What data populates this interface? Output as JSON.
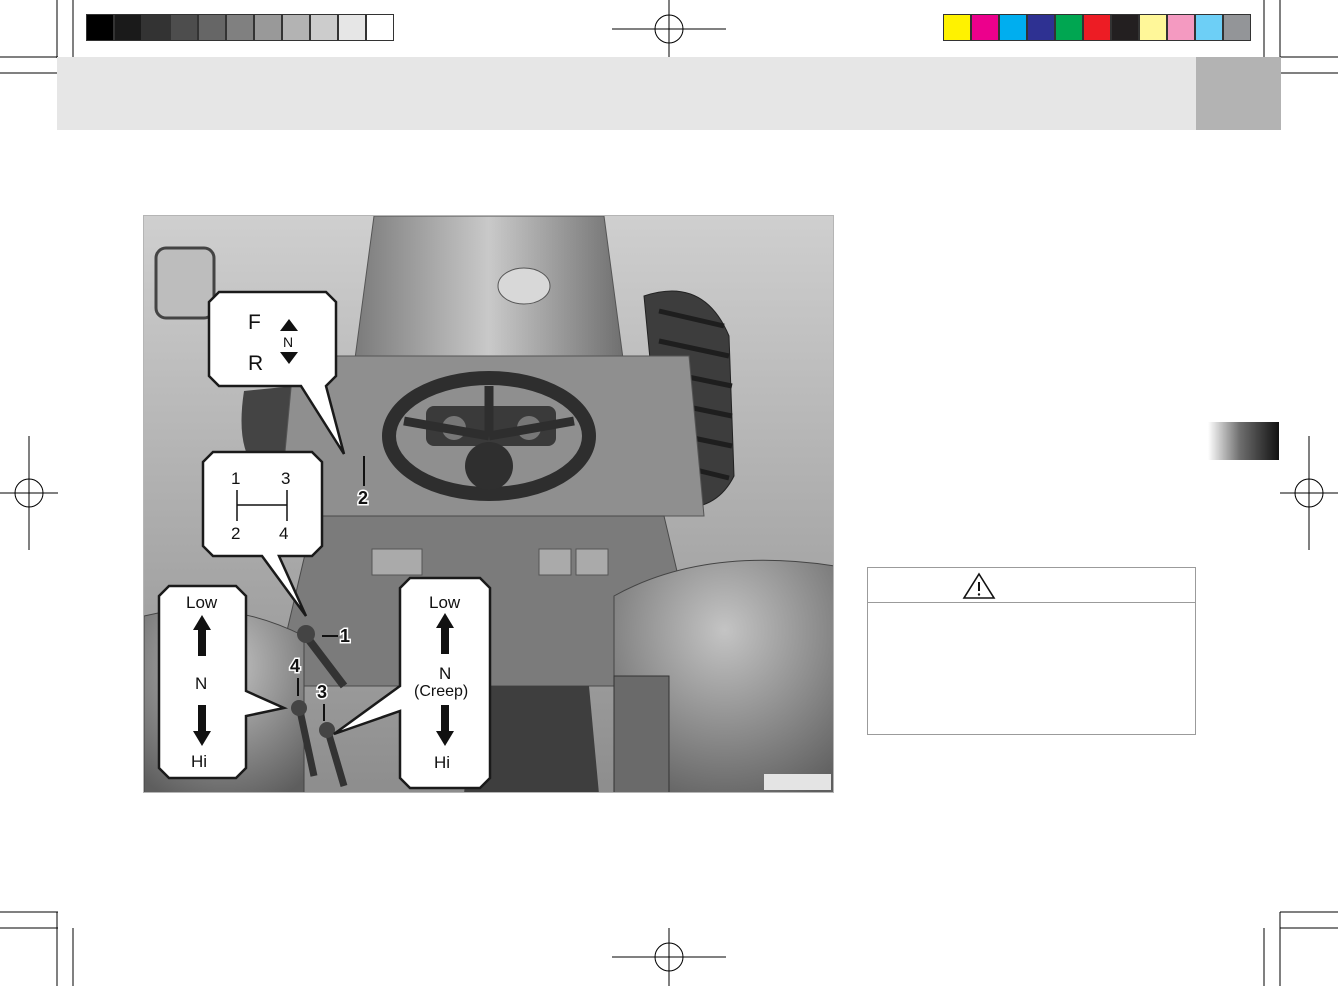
{
  "color_bar": {
    "grayscale": [
      "#000000",
      "#1a1a1a",
      "#333333",
      "#4d4d4d",
      "#666666",
      "#808080",
      "#999999",
      "#b3b3b3",
      "#cccccc",
      "#e6e6e6",
      "#ffffff"
    ],
    "process": [
      "#fff200",
      "#ec008c",
      "#00aeef",
      "#2e3192",
      "#00a651",
      "#ed1c24",
      "#231f20",
      "#fff799",
      "#f49ac1",
      "#6dcff6",
      "#939598"
    ]
  },
  "figure": {
    "callouts": {
      "shuttle": {
        "forward": "F",
        "reverse": "R",
        "neutral": "N"
      },
      "main_gear": {
        "g1": "1",
        "g2": "2",
        "g3": "3",
        "g4": "4"
      },
      "range_left": {
        "low": "Low",
        "neutral": "N",
        "high": "Hi"
      },
      "range_right": {
        "low": "Low",
        "neutral": "N",
        "creep": "(Creep)",
        "high": "Hi"
      }
    },
    "part_numbers": {
      "p1": "1",
      "p2": "2",
      "p3": "3",
      "p4": "4"
    }
  },
  "warning": {
    "icon": "warning-triangle-icon"
  }
}
